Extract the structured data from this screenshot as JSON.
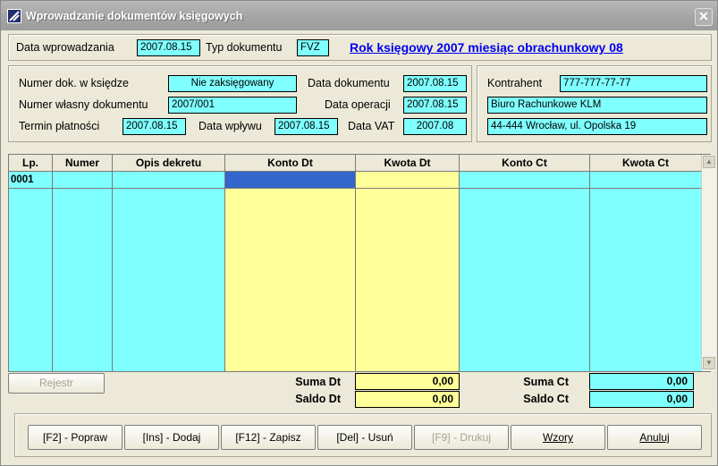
{
  "window": {
    "title": "Wprowadzanie dokumentów księgowych",
    "close_glyph": "✕"
  },
  "header": {
    "entry_date_label": "Data wprowadzania",
    "entry_date": "2007.08.15",
    "doc_type_label": "Typ dokumentu",
    "doc_type": "FVZ",
    "period_link": "Rok księgowy 2007 miesiąc obrachunkowy 08"
  },
  "doc": {
    "ledger_no_label": "Numer dok. w księdze",
    "ledger_no": "Nie zaksięgowany",
    "own_no_label": "Numer własny dokumentu",
    "own_no": "2007/001",
    "due_label": "Termin płatności",
    "due": "2007.08.15",
    "inflow_label": "Data wpływu",
    "inflow": "2007.08.15",
    "doc_date_label": "Data dokumentu",
    "doc_date": "2007.08.15",
    "op_date_label": "Data operacji",
    "op_date": "2007.08.15",
    "vat_label": "Data VAT",
    "vat": "2007.08"
  },
  "contractor": {
    "label": "Kontrahent",
    "nip": "777-777-77-77",
    "name": "Biuro Rachunkowe KLM",
    "address": "44-444 Wrocław, ul. Opolska 19"
  },
  "table": {
    "columns": [
      "Lp.",
      "Numer",
      "Opis dekretu",
      "Konto Dt",
      "Kwota Dt",
      "Konto Ct",
      "Kwota Ct"
    ],
    "rows": [
      [
        "0001",
        "",
        "",
        "",
        "",
        "",
        ""
      ]
    ]
  },
  "totals": {
    "register_label": "Rejestr",
    "sum_dt_label": "Suma Dt",
    "sum_dt": "0,00",
    "saldo_dt_label": "Saldo Dt",
    "saldo_dt": "0,00",
    "sum_ct_label": "Suma Ct",
    "sum_ct": "0,00",
    "saldo_ct_label": "Saldo Ct",
    "saldo_ct": "0,00"
  },
  "buttons": {
    "edit": "[F2] - Popraw",
    "add": "[Ins] - Dodaj",
    "save": "[F12] - Zapisz",
    "delete": "[Del] - Usuń",
    "print": "[F9] - Drukuj",
    "templates": "Wzory",
    "cancel": "Anuluj"
  },
  "colors": {
    "field_cyan": "#80FFFF",
    "field_yellow": "#FFFF99",
    "selection_blue": "#3366CC",
    "link_blue": "#0000EE"
  }
}
